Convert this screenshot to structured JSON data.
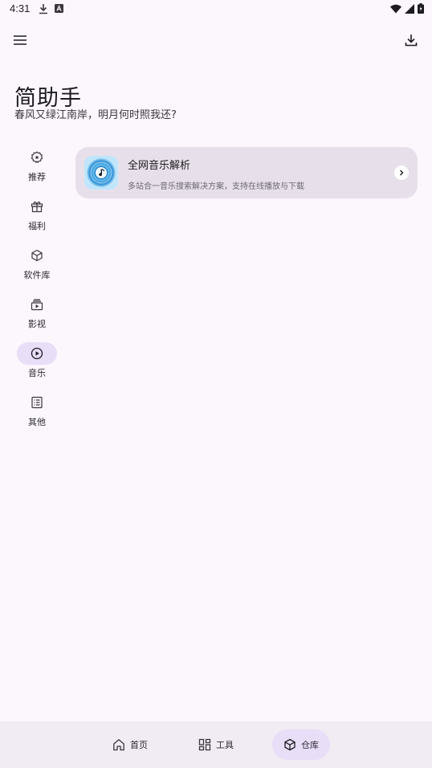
{
  "status_bar": {
    "time": "4:31"
  },
  "app": {
    "title": "简助手",
    "subtitle": "春风又绿江南岸，明月何时照我还?"
  },
  "side_nav": {
    "items": [
      {
        "label": "推荐",
        "icon": "gear-star-icon",
        "active": false
      },
      {
        "label": "福利",
        "icon": "gift-icon",
        "active": false
      },
      {
        "label": "软件库",
        "icon": "cube-icon",
        "active": false
      },
      {
        "label": "影视",
        "icon": "tv-play-icon",
        "active": false
      },
      {
        "label": "音乐",
        "icon": "play-circle-icon",
        "active": true
      },
      {
        "label": "其他",
        "icon": "list-icon",
        "active": false
      }
    ]
  },
  "card": {
    "title": "全网音乐解析",
    "description": "多站合一音乐搜索解决方案，支持在线播放与下载",
    "icon": "music-disc-icon"
  },
  "bottom_nav": {
    "items": [
      {
        "label": "首页",
        "icon": "home-icon",
        "active": false
      },
      {
        "label": "工具",
        "icon": "grid-icon",
        "active": false
      },
      {
        "label": "仓库",
        "icon": "cube-icon",
        "active": true
      }
    ]
  },
  "colors": {
    "background": "#fcf6fd",
    "card": "#e7e0ea",
    "active_pill": "#e8def8",
    "bottom_bar": "#f1ebf3"
  }
}
